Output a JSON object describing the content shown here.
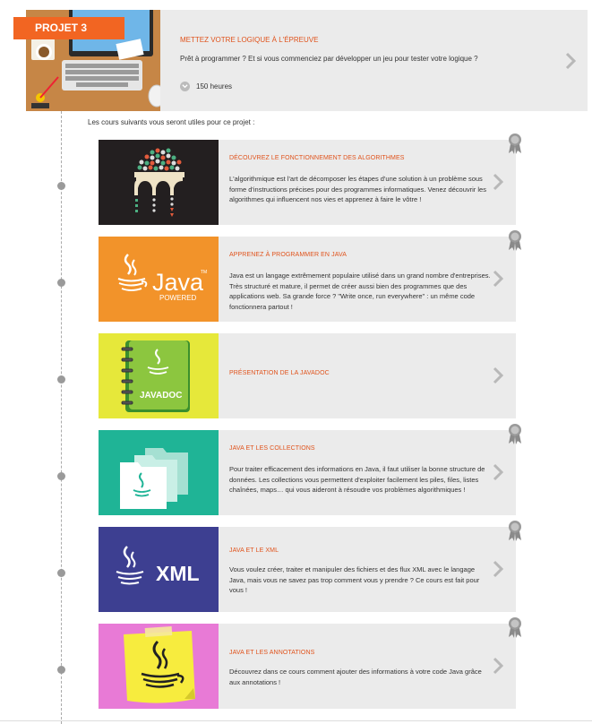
{
  "project": {
    "badge": "PROJET 3",
    "title": "METTEZ VOTRE LOGIQUE À L'ÉPREUVE",
    "description": "Prêt à programmer ? Et si vous commenciez par développer un jeu pour tester votre logique ?",
    "hours": "150 heures"
  },
  "intro": "Les cours suivants vous seront utiles pour ce projet :",
  "courses": [
    {
      "title": "DÉCOUVREZ LE FONCTIONNEMENT DES ALGORITHMES",
      "description": "L'algorithmique est l'art de décomposer les étapes d'une solution à un problème sous forme d'instructions précises pour des programmes informatiques. Venez découvrir les algorithmes qui influencent nos vies et apprenez à faire le vôtre !",
      "bg": "#231f20"
    },
    {
      "title": "APPRENEZ À PROGRAMMER EN JAVA",
      "description": "Java est un langage extrêmement populaire utilisé dans un grand nombre d'entreprises. Très structuré et mature, il permet de créer aussi bien des programmes que des applications web. Sa grande force ? \"Write once, run everywhere\" : un même code fonctionnera partout !",
      "bg": "#f2932a",
      "logo_text": "Java",
      "logo_tm": "TM",
      "logo_sub": "POWERED"
    },
    {
      "title": "PRÉSENTATION DE LA JAVADOC",
      "description": "",
      "bg": "#e6e83a",
      "logo_text": "JAVADOC"
    },
    {
      "title": "JAVA ET LES COLLECTIONS",
      "description": "Pour traiter efficacement des informations en Java, il faut utiliser la bonne structure de données. Les collections vous permettent d'exploiter facilement les piles, files, listes chaînées, maps… qui vous aideront à résoudre vos problèmes algorithmiques !",
      "bg": "#1fb496"
    },
    {
      "title": "JAVA ET LE XML",
      "description": "Vous voulez créer, traiter et manipuler des fichiers et des flux XML avec le langage Java, mais vous ne savez pas trop comment vous y prendre ? Ce cours est fait pour vous !",
      "bg": "#3d3f91",
      "logo_text": "XML"
    },
    {
      "title": "JAVA ET LES ANNOTATIONS",
      "description": "Découvrez dans ce cours comment ajouter des informations à votre code Java grâce aux annotations !",
      "bg": "#e87ad6"
    }
  ],
  "icons": {
    "arrow": "chevron-right-icon",
    "badge": "medal-icon",
    "time": "clock-icon"
  },
  "colors": {
    "accent": "#f26522",
    "title": "#e0531c",
    "card": "#ebebeb"
  }
}
